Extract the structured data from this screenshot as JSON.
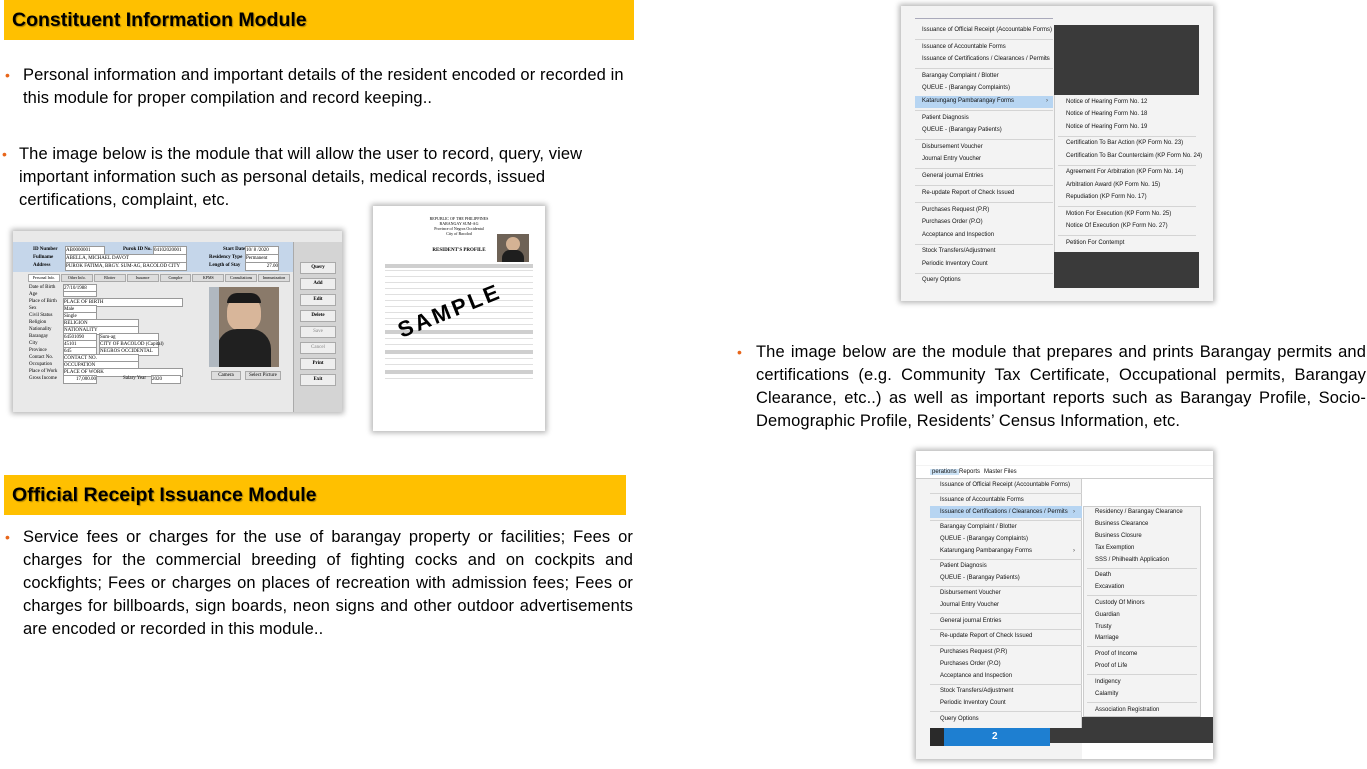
{
  "section1": {
    "title": "Constituent Information Module",
    "bullet1": "Personal information and important details of the resident encoded or recorded in this module for proper compilation and record keeping..",
    "bullet2": "The image below is the module that will allow the user to record, query, view important information such as personal details, medical records, issued certifications, complaint, etc."
  },
  "section2": {
    "title": "Official Receipt Issuance Module",
    "bullet1": "Service fees or charges for the use of barangay property or facilities; Fees or charges for the commercial breeding of fighting cocks and on cockpits and cockfights; Fees or charges on places of recreation with admission fees;  Fees or charges for billboards, sign boards, neon signs and other outdoor advertisements are encoded or recorded in this module.."
  },
  "section3": {
    "bullet1": "The image below are the module that prepares and prints Barangay permits and certifications (e.g. Community Tax Certificate, Occupational permits, Barangay Clearance, etc..) as well as important reports such as Barangay Profile, Socio-Demographic Profile, Residents’ Census Information, etc."
  },
  "form": {
    "id_label": "ID Number",
    "id_value": "AB0000001",
    "purok_label": "Purok ID No.",
    "purok_value": "04102020001",
    "start_label": "Start Date:",
    "start_value": "10/ 8 /2020",
    "fullname_label": "Fullname",
    "fullname_value": "ABELLA, MICHAEL DAVOT",
    "restype_label": "Residency Type",
    "restype_value": "Permanent",
    "address_label": "Address",
    "address_value": "PUROK FATIMA, BRGY. SUM-AG, BACOLOD CITY",
    "length_label": "Length of Stay",
    "length_value": "27.00",
    "tabs": [
      "Personal Info.",
      "Other Info.",
      "Blotter",
      "Issuance",
      "Complre",
      "KPMS",
      "Consultations",
      "Immunization"
    ],
    "fields": [
      {
        "label": "Date of Birth",
        "value": "27/10/1988"
      },
      {
        "label": "Age",
        "value": ""
      },
      {
        "label": "Place of Birth",
        "value": "PLACE OF BIRTH"
      },
      {
        "label": "Sex",
        "value": "Male"
      },
      {
        "label": "Civil Status",
        "value": "Single"
      },
      {
        "label": "Religion",
        "value": "RELIGION"
      },
      {
        "label": "Nationality",
        "value": "NATIONALITY"
      },
      {
        "label": "Barangay",
        "value": "64501090"
      },
      {
        "label": "City",
        "value": "45101"
      },
      {
        "label": "Province",
        "value": "645"
      },
      {
        "label": "Contact No.",
        "value": "CONTACT NO."
      },
      {
        "label": "Occupation",
        "value": "OCCUPATION"
      },
      {
        "label": "Place of Work",
        "value": "PLACE OF WORK"
      },
      {
        "label": "Gross Income",
        "value": "17,000.00"
      }
    ],
    "barangay_name": "Sum-ag",
    "city_name": "CITY OF BACOLOD (Capital)",
    "province_name": "NEGROS OCCIDENTAL",
    "salary_label": "Salary Year",
    "salary_value": "2020",
    "buttons": [
      "Query",
      "Add",
      "Edit",
      "Delete",
      "Save",
      "Cancel",
      "Print",
      "Exit"
    ],
    "camera_label": "Camera",
    "select_label": "Select Picture"
  },
  "profile_doc": {
    "header1": "REPUBLIC OF THE PHILIPPINES",
    "header2": "BARANGAY SUM-AG",
    "header3": "Province of Negros Occidental",
    "header4": "City of Bacolod",
    "title": "RESIDENT'S PROFILE",
    "watermark": "SAMPLE"
  },
  "menu1": {
    "items": [
      "Issuance of Official Receipt (Accountable Forms)",
      "Issuance of Accountable Forms",
      "Issuance of Certifications / Clearances / Permits",
      "Barangay Complaint / Blotter",
      "QUEUE - (Barangay Complaints)",
      "Katarungang Pambarangay Forms",
      "Patient Diagnosis",
      "QUEUE - (Barangay Patients)",
      "Disbursement Voucher",
      "Journal Entry Voucher",
      "General journal Entries",
      "Re-update Report of Check Issued",
      "Purchases Request (P.R)",
      "Purchases Order (P.O)",
      "Acceptance and Inspection",
      "Stock Transfers/Adjustment",
      "Periodic Inventory Count",
      "Query Options"
    ],
    "submenu": [
      "Notice of Hearing Form No. 12",
      "Notice of Hearing Form No. 18",
      "Notice of Hearing Form No. 19",
      "Certification To Bar Action (KP Form No. 23)",
      "Certification To Bar Counterclaim (KP Form No. 24)",
      "Agreement For Arbitration (KP Form No. 14)",
      "Arbitration Award (KP Form No. 15)",
      "Repudiation (KP Form No. 17)",
      "Motion For Execution (KP Form No. 25)",
      "Notice Of Execution (KP Form No. 27)",
      "Petition For Contempt"
    ]
  },
  "menu2": {
    "menubar": [
      "perations",
      "Reports",
      "Master Files"
    ],
    "items": [
      "Issuance of Official Receipt (Accountable Forms)",
      "Issuance of Accountable Forms",
      "Issuance of Certifications / Clearances / Permits",
      "Barangay Complaint / Blotter",
      "QUEUE - (Barangay Complaints)",
      "Katarungang Pambarangay Forms",
      "Patient Diagnosis",
      "QUEUE - (Barangay Patients)",
      "Disbursement Voucher",
      "Journal Entry Voucher",
      "General journal Entries",
      "Re-update Report of Check Issued",
      "Purchases Request (P.R)",
      "Purchases Order (P.O)",
      "Acceptance and Inspection",
      "Stock Transfers/Adjustment",
      "Periodic Inventory Count",
      "Query Options"
    ],
    "submenu": [
      "Residency / Barangay Clearance",
      "Business Clearance",
      "Business Closure",
      "Tax Exemption",
      "SSS / Philhealth Application",
      "Death",
      "Excavation",
      "Custody Of Minors",
      "Guardian",
      "Trusty",
      "Marriage",
      "Proof of Income",
      "Proof of Life",
      "Indigency",
      "Calamity",
      "Association Registration"
    ],
    "taskbar_number": "2"
  },
  "colors": {
    "banner": "#ffc000",
    "bullet": "#e8661a",
    "highlight": "#b7d5f2",
    "dark_panel": "#3a3a3a"
  }
}
